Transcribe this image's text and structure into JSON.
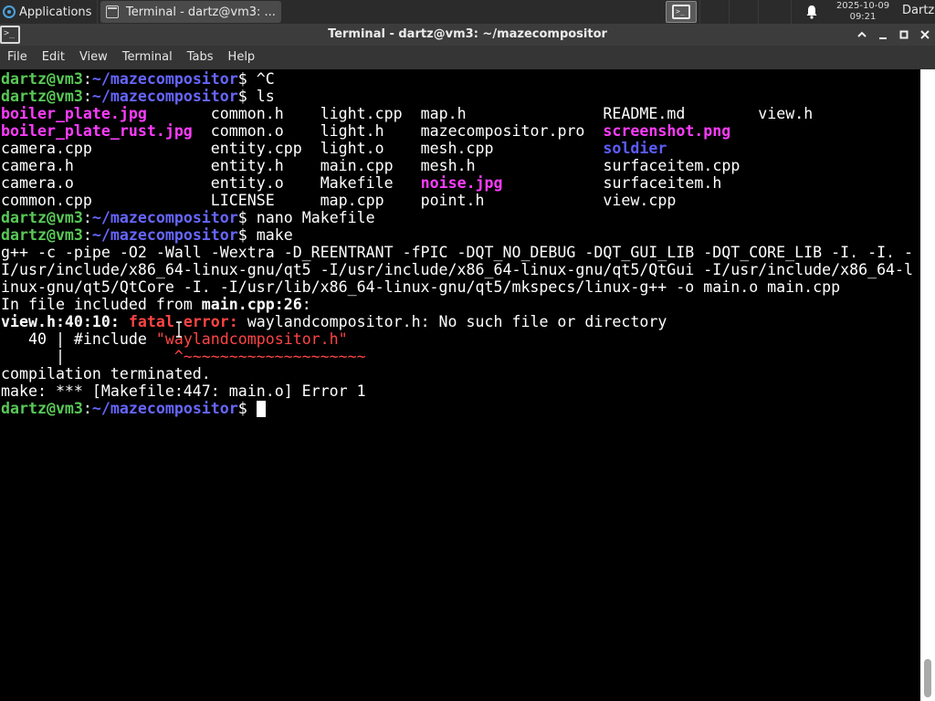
{
  "panel": {
    "applications_label": "Applications",
    "task_title": "Terminal - dartz@vm3: ...",
    "clock_date": "2025-10-09",
    "clock_time": "09:21",
    "user": "Dartz"
  },
  "window": {
    "title": "Terminal - dartz@vm3: ~/mazecompositor"
  },
  "menubar": {
    "file": "File",
    "edit": "Edit",
    "view": "View",
    "terminal": "Terminal",
    "tabs": "Tabs",
    "help": "Help"
  },
  "terminal": {
    "user_host": "dartz@vm3",
    "colon": ":",
    "path": "~/mazecompositor",
    "dollar": "$ ",
    "cmd1": "^C",
    "cmd2": "ls",
    "ls_rows": [
      [
        "boiler_plate.jpg",
        "common.h",
        "light.cpp",
        "map.h",
        "README.md",
        "view.h"
      ],
      [
        "boiler_plate_rust.jpg",
        "common.o",
        "light.h",
        "mazecompositor.pro",
        "screenshot.png",
        ""
      ],
      [
        "camera.cpp",
        "entity.cpp",
        "light.o",
        "mesh.cpp",
        "soldier",
        ""
      ],
      [
        "camera.h",
        "entity.h",
        "main.cpp",
        "mesh.h",
        "surfaceitem.cpp",
        ""
      ],
      [
        "camera.o",
        "entity.o",
        "Makefile",
        "noise.jpg",
        "surfaceitem.h",
        ""
      ],
      [
        "common.cpp",
        "LICENSE",
        "map.cpp",
        "point.h",
        "view.cpp",
        ""
      ]
    ],
    "cmd3": "nano Makefile",
    "cmd4": "make",
    "gpp_line1": "g++ -c -pipe -O2 -Wall -Wextra -D_REENTRANT -fPIC -DQT_NO_DEBUG -DQT_GUI_LIB -DQT_CORE_LIB -I. -I. -",
    "gpp_line2": "I/usr/include/x86_64-linux-gnu/qt5 -I/usr/include/x86_64-linux-gnu/qt5/QtGui -I/usr/include/x86_64-l",
    "gpp_line3": "inux-gnu/qt5/QtCore -I. -I/usr/lib/x86_64-linux-gnu/qt5/mkspecs/linux-g++ -o main.o main.cpp",
    "included_prefix": "In file included from ",
    "included_file": "main.cpp:26",
    "included_suffix": ":",
    "err_loc": "view.h:40:10:",
    "err_fatal": "fatal error:",
    "err_msg": " waylandcompositor.h: No such file or directory",
    "src_prefix": "   40 | #include ",
    "src_include": "\"waylandcompositor.h\"",
    "src_bar": "      |",
    "src_marker": "                  ^~~~~~~~~~~~~~~~~~~~~",
    "terminated": "compilation terminated.",
    "make_error": "make: *** [Makefile:447: main.o] Error 1"
  },
  "colors": {
    "prompt_user": "#59c957",
    "prompt_path": "#6666ff",
    "image_file": "#ff3cff",
    "directory": "#5c5cff",
    "error": "#ff4444"
  }
}
